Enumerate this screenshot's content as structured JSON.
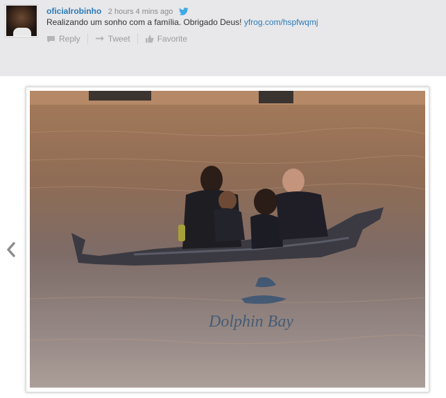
{
  "tweet": {
    "username": "oficialrobinho",
    "timestamp": "2 hours 4 mins ago",
    "text": "Realizando um sonho com a família. Obrigado Deus! ",
    "link": "yfrog.com/hspfwqmj"
  },
  "actions": [
    {
      "label": "Reply",
      "icon": "reply-icon"
    },
    {
      "label": "Tweet",
      "icon": "retweet-icon"
    },
    {
      "label": "Favorite",
      "icon": "thumbs-up-icon"
    }
  ],
  "photo": {
    "watermark": "Dolphin Bay"
  },
  "colors": {
    "header_bg": "#e8e8ea",
    "link": "#2a7ab8",
    "twitter_bird": "#3fa9e8"
  }
}
